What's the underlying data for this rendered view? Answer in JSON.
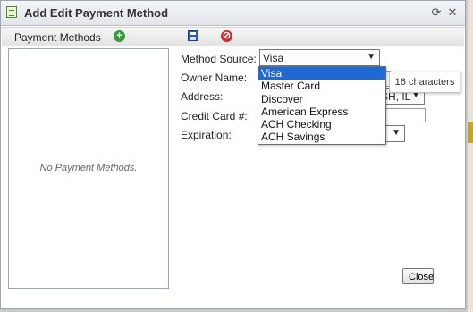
{
  "window": {
    "title": "Add Edit Payment Method"
  },
  "toolbar": {
    "label": "Payment Methods"
  },
  "list_panel": {
    "empty_text": "No Payment Methods."
  },
  "form": {
    "method_source_label": "Method Source:",
    "method_source_value": "Visa",
    "owner_name_label": "Owner Name:",
    "address_label": "Address:",
    "address_value": "SH, IL",
    "credit_card_label": "Credit Card #:",
    "expiration_label": "Expiration:"
  },
  "dropdown": {
    "options": [
      "Visa",
      "Master Card",
      "Discover",
      "American Express",
      "ACH Checking",
      "ACH Savings"
    ],
    "selected_index": 0
  },
  "tooltip": {
    "text": "16 characters"
  },
  "buttons": {
    "close_label": "Close"
  },
  "colors": {
    "selection": "#1e6ad4",
    "add": "#3a9a3a",
    "cancel": "#d02a2a",
    "save": "#2d5fb0"
  }
}
